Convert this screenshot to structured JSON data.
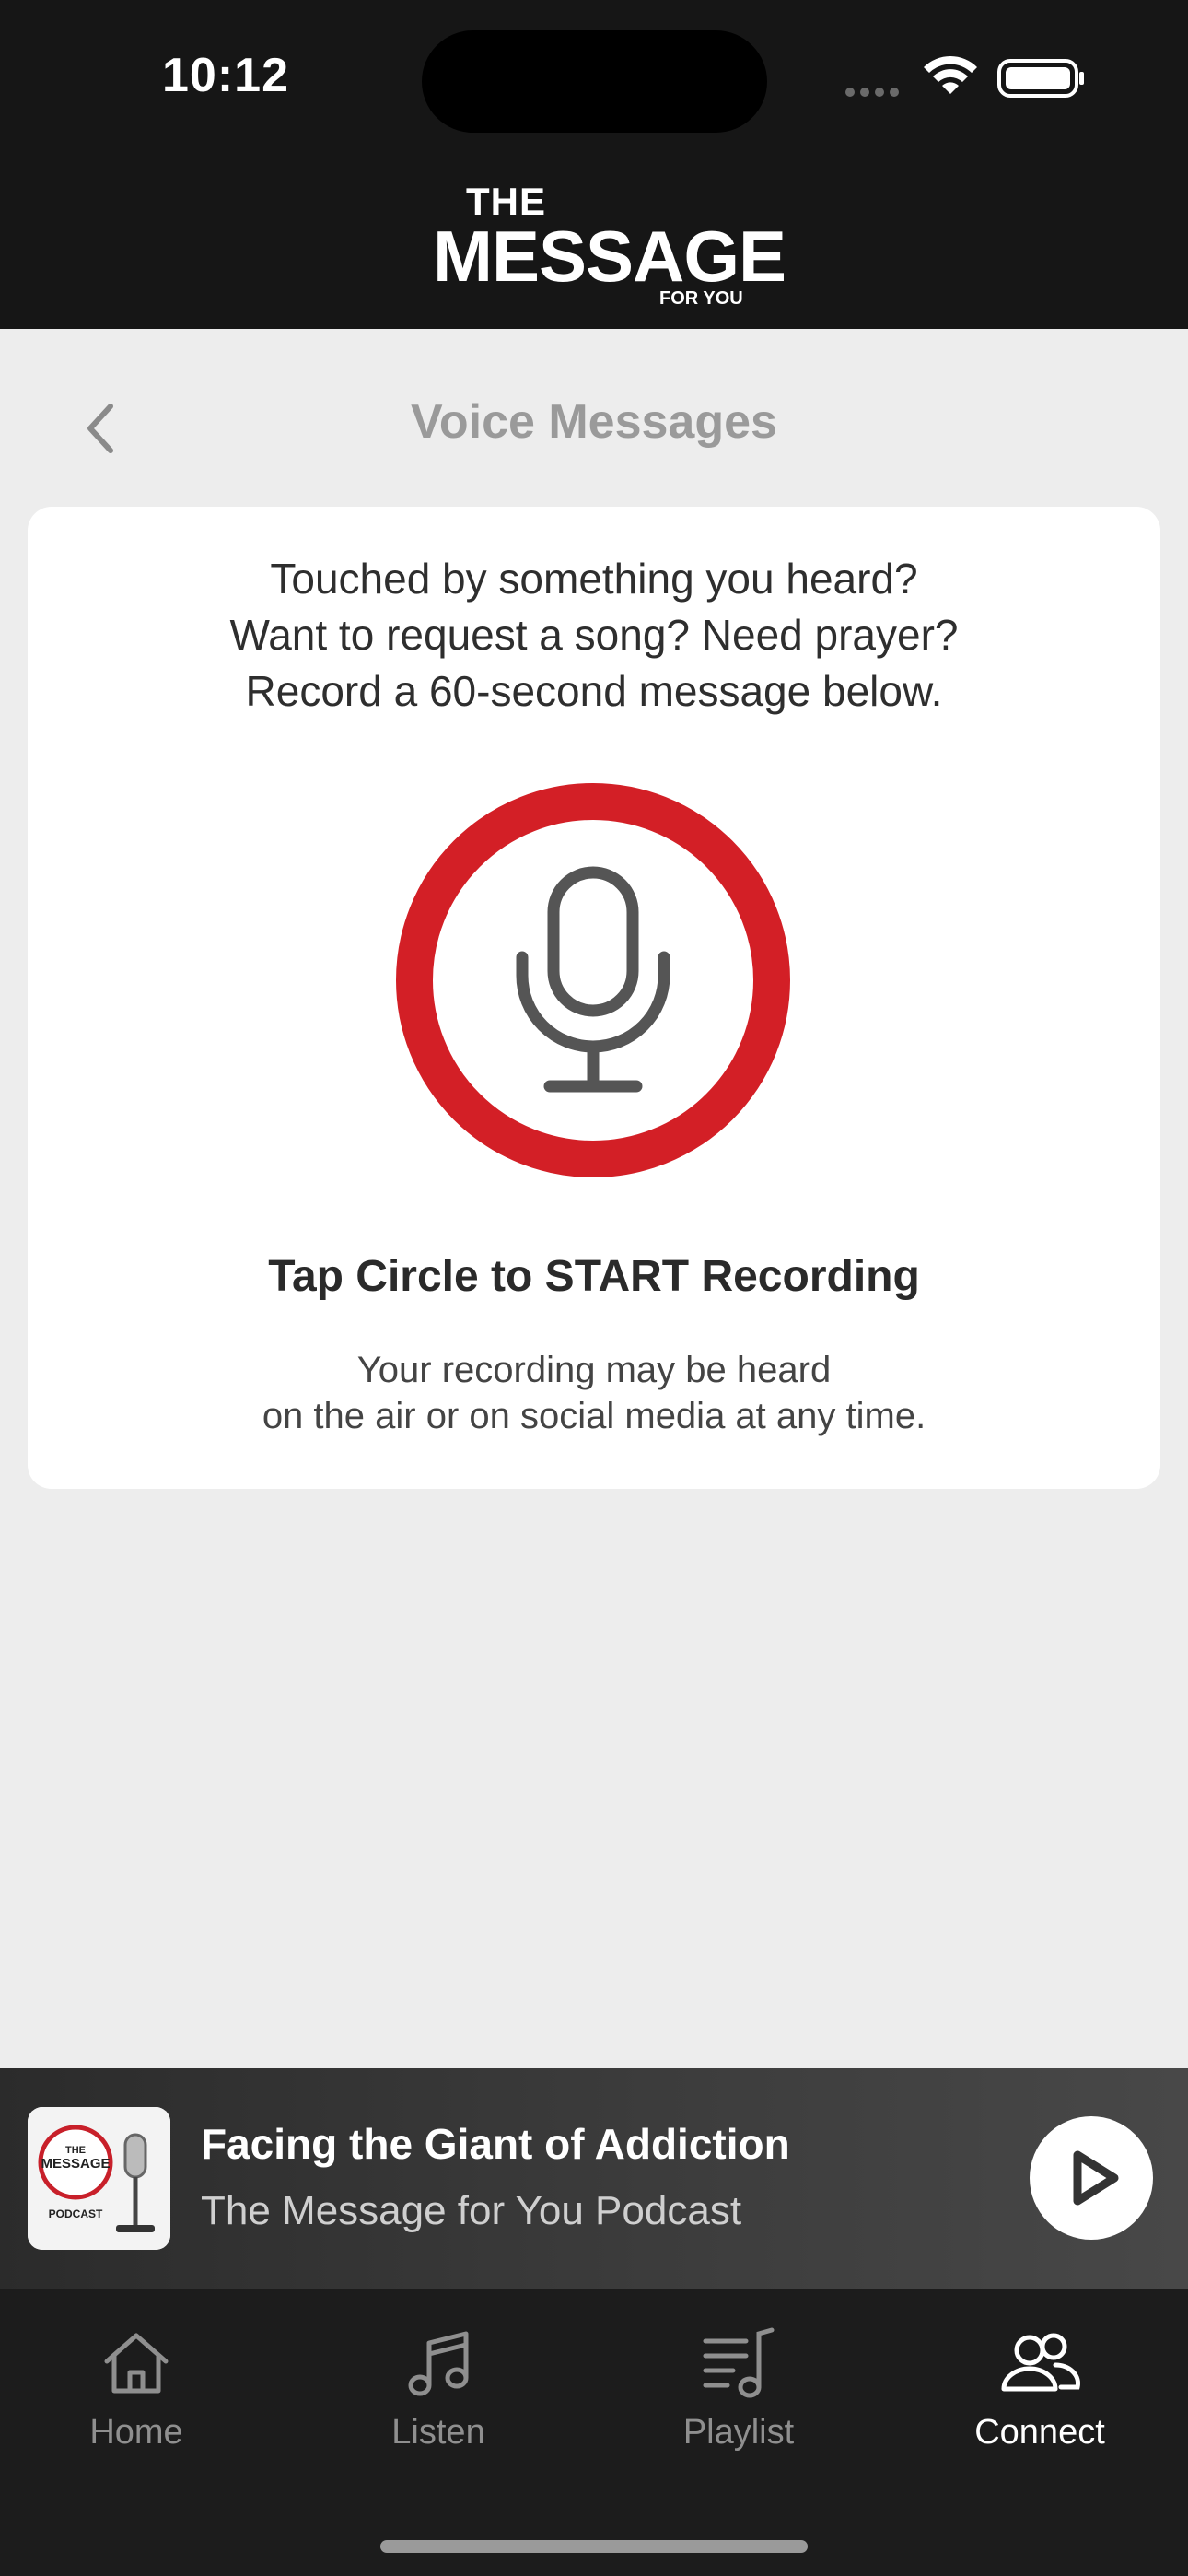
{
  "status_bar": {
    "time": "10:12"
  },
  "brand": {
    "line1": "THE",
    "line2": "MESSAGE",
    "line3": "FOR YOU"
  },
  "nav": {
    "title": "Voice Messages"
  },
  "card": {
    "intro_lines": [
      "Touched by something you heard?",
      "Want to request a song? Need prayer?",
      "Record a 60-second message below."
    ],
    "record_icon": "microphone-icon",
    "cta": "Tap Circle to START Recording",
    "disclaimer_lines": [
      "Your recording may be heard",
      "on the air or on social media at any time."
    ]
  },
  "now_playing": {
    "title": "Facing the Giant of Addiction",
    "subtitle": "The Message for You Podcast",
    "thumbnail_text": {
      "line1": "THE",
      "line2": "MESSAGE",
      "line3": "PODCAST"
    }
  },
  "tabs": [
    {
      "label": "Home",
      "icon": "home-icon",
      "active": false
    },
    {
      "label": "Listen",
      "icon": "music-note-icon",
      "active": false
    },
    {
      "label": "Playlist",
      "icon": "playlist-icon",
      "active": false
    },
    {
      "label": "Connect",
      "icon": "people-icon",
      "active": true
    }
  ],
  "colors": {
    "accent_red": "#d31f26",
    "header_bg": "#161616",
    "tabbar_bg": "#1c1c1c",
    "page_bg": "#ededed"
  }
}
